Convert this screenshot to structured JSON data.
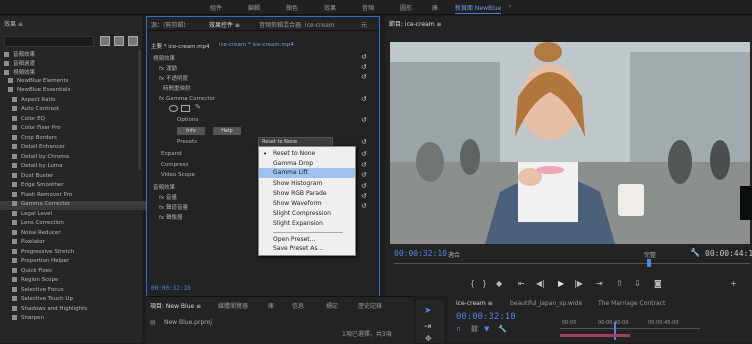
{
  "workspace": {
    "tabs": [
      "組件",
      "編輯",
      "顏色",
      "效果",
      "音頻",
      "圖形",
      "庫",
      "新頁面 NewBlue"
    ],
    "active_index": 7
  },
  "effects_panel": {
    "header": "效果 ≡",
    "groups": [
      "音頻效果",
      "音頻過渡",
      "視頻效果"
    ],
    "items": [
      "NewBlue Elements",
      "NewBlue Essentials",
      "Aspect Ratio",
      "Auto Contrast",
      "Color EQ",
      "Color Fixer Pro",
      "Crop Borders",
      "Detail Enhancer",
      "Detail by Chroma",
      "Detail by Luma",
      "Dust Buster",
      "Edge Smoother",
      "Flash Remover Pro",
      "Gamma Corrector",
      "Legal Level",
      "Lens Correction",
      "Noise Reducer",
      "Pixelator",
      "Progressive Stretch",
      "Proportion Helper",
      "Quick Fixes",
      "Region Scope",
      "Selective Focus",
      "Selective Touch Up",
      "Shadows and Highlights",
      "Sharpen"
    ],
    "selected": "Gamma Corrector"
  },
  "effect_controls": {
    "tabs": [
      "源：(無剪輯)",
      "效果控件 ≡",
      "音頻剪輯混合器: ice-cream",
      "元"
    ],
    "master_label": "主要 * ice-cream.mp4",
    "sequence_label": "ice-cream * ice-cream.mp4",
    "sections": {
      "video_effects": "視頻效果",
      "motion": "fx 運動",
      "opacity": "fx 不透明度",
      "time_remap": "時間重映射",
      "gamma": "fx Gamma Corrector",
      "options": "Options",
      "info_btn": "Info",
      "help_btn": "Help",
      "presets": "Presets",
      "expand": "Expand",
      "compress": "Compress",
      "video_scope": "Video Scope",
      "audio_effects": "音頻效果",
      "volume": "fx 音量",
      "channel_volume": "fx 聲道音量",
      "panner": "fx 聲像器"
    },
    "timecode": "00:00:32:10"
  },
  "preset_dropdown": {
    "value": "Reset to None",
    "options": [
      "Reset to None",
      "Gamma Drop",
      "Gamma Lift",
      "Show Histogram",
      "Show RGB Parade",
      "Show Waveform",
      "Slight Compression",
      "Slight Expansion",
      "Open Preset...",
      "Save Preset As..."
    ],
    "checked_index": 0,
    "highlighted_index": 2
  },
  "program_monitor": {
    "title": "節目: ice-cream ≡",
    "timecode": "00:00:32:10",
    "duration": "00:00:44:17",
    "fit": "適合",
    "quality": "完整",
    "playhead_fraction": 0.73
  },
  "project_panel": {
    "tabs": [
      "項目: New Blue ≡",
      "媒體瀏覽器",
      "庫",
      "信息",
      "標記",
      "歷史記錄"
    ],
    "file": "New Blue.prproj",
    "status": "1項已選擇，共3項"
  },
  "timeline": {
    "tabs": [
      "ice-cream ≡",
      "beautiful_japan_sp.wide",
      "The Marriage Contract"
    ],
    "timecode": "00:00:32:10",
    "ruler": [
      "00:00",
      "00:00:30:00",
      "00:00:45:00"
    ]
  }
}
